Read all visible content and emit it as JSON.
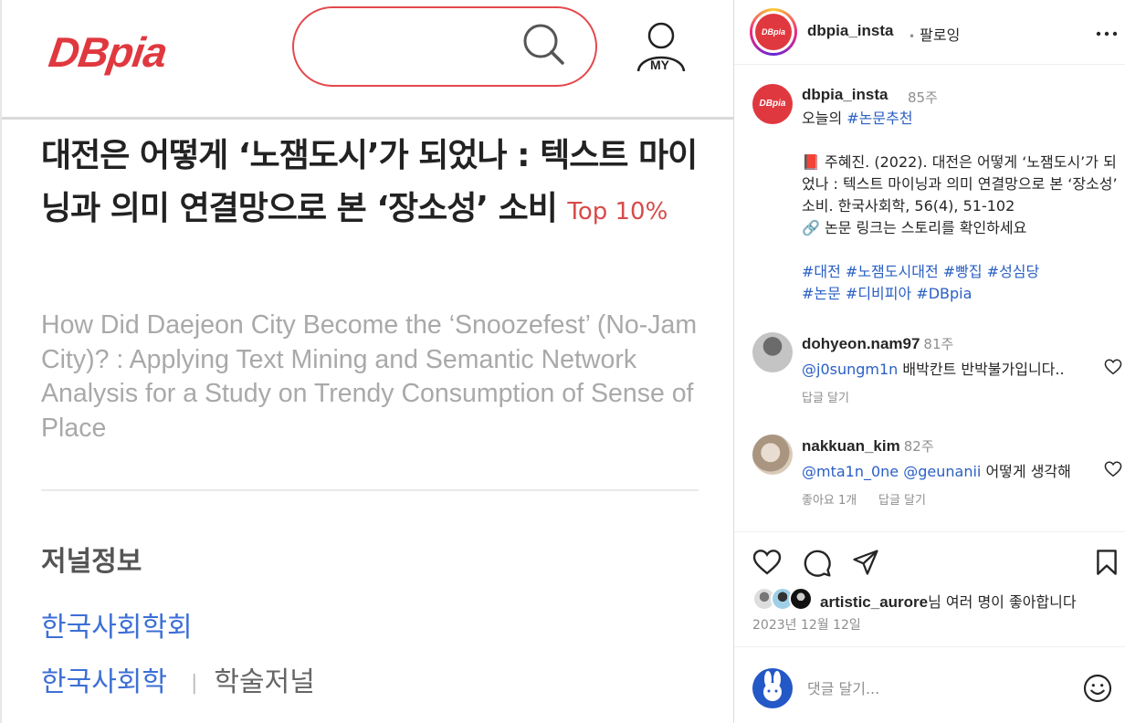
{
  "post_image": {
    "logo": "DBpia",
    "my_label": "MY",
    "title": "대전은 어떻게 ‘노잼도시’가 되었나 : 텍스트 마이닝과 의미 연결망으로 본 ‘장소성’ 소비",
    "top_badge": "Top 10%",
    "subtitle": "How Did Daejeon City Become the ‘Snoozefest’ (No-Jam City)? : Applying Text Mining and Semantic Network Analysis for a Study on Trendy Consumption of Sense of Place",
    "section_heading": "저널정보",
    "publisher": "한국사회학회",
    "journal": "한국사회학",
    "journal_type": "학술저널"
  },
  "header": {
    "username": "dbpia_insta",
    "follow_sep": "•",
    "follow_label": "팔로잉"
  },
  "caption": {
    "username": "dbpia_insta",
    "time": "85주",
    "line1_prefix": "오늘의 ",
    "line1_tag": "#논문추천",
    "body": "📕 주혜진. (2022). 대전은 어떻게 ‘노잼도시’가 되었나 : 텍스트 마이닝과 의미 연결망으로 본 ‘장소성’ 소비. 한국사회학, 56(4), 51-102",
    "link_line": "🔗 논문 링크는 스토리를 확인하세요",
    "tags_line1": "#대전 #노잼도시대전 #빵집 #성심당",
    "tags_line2": "#논문 #디비피아 #DBpia"
  },
  "comments": [
    {
      "username": "dohyeon.nam97",
      "time": "81주",
      "mention": "@j0sungm1n",
      "text": " 배박칸트 반박불가입니다..",
      "meta": "답글 달기"
    },
    {
      "username": "nakkuan_kim",
      "time": "82주",
      "mention": "@mta1n_0ne @geunanii",
      "text": " 어떻게 생각해",
      "likes": "좋아요 1개",
      "meta": "답글 달기"
    }
  ],
  "likes": {
    "user": "artistic_aurore",
    "suffix": "님 여러 명이 좋아합니다"
  },
  "date": "2023년 12월 12일",
  "comment_input": {
    "placeholder": "댓글 달기..."
  },
  "colors": {
    "brand_red": "#e0383f",
    "link_blue": "#2a5fc4",
    "muted": "#8e8e8e"
  }
}
